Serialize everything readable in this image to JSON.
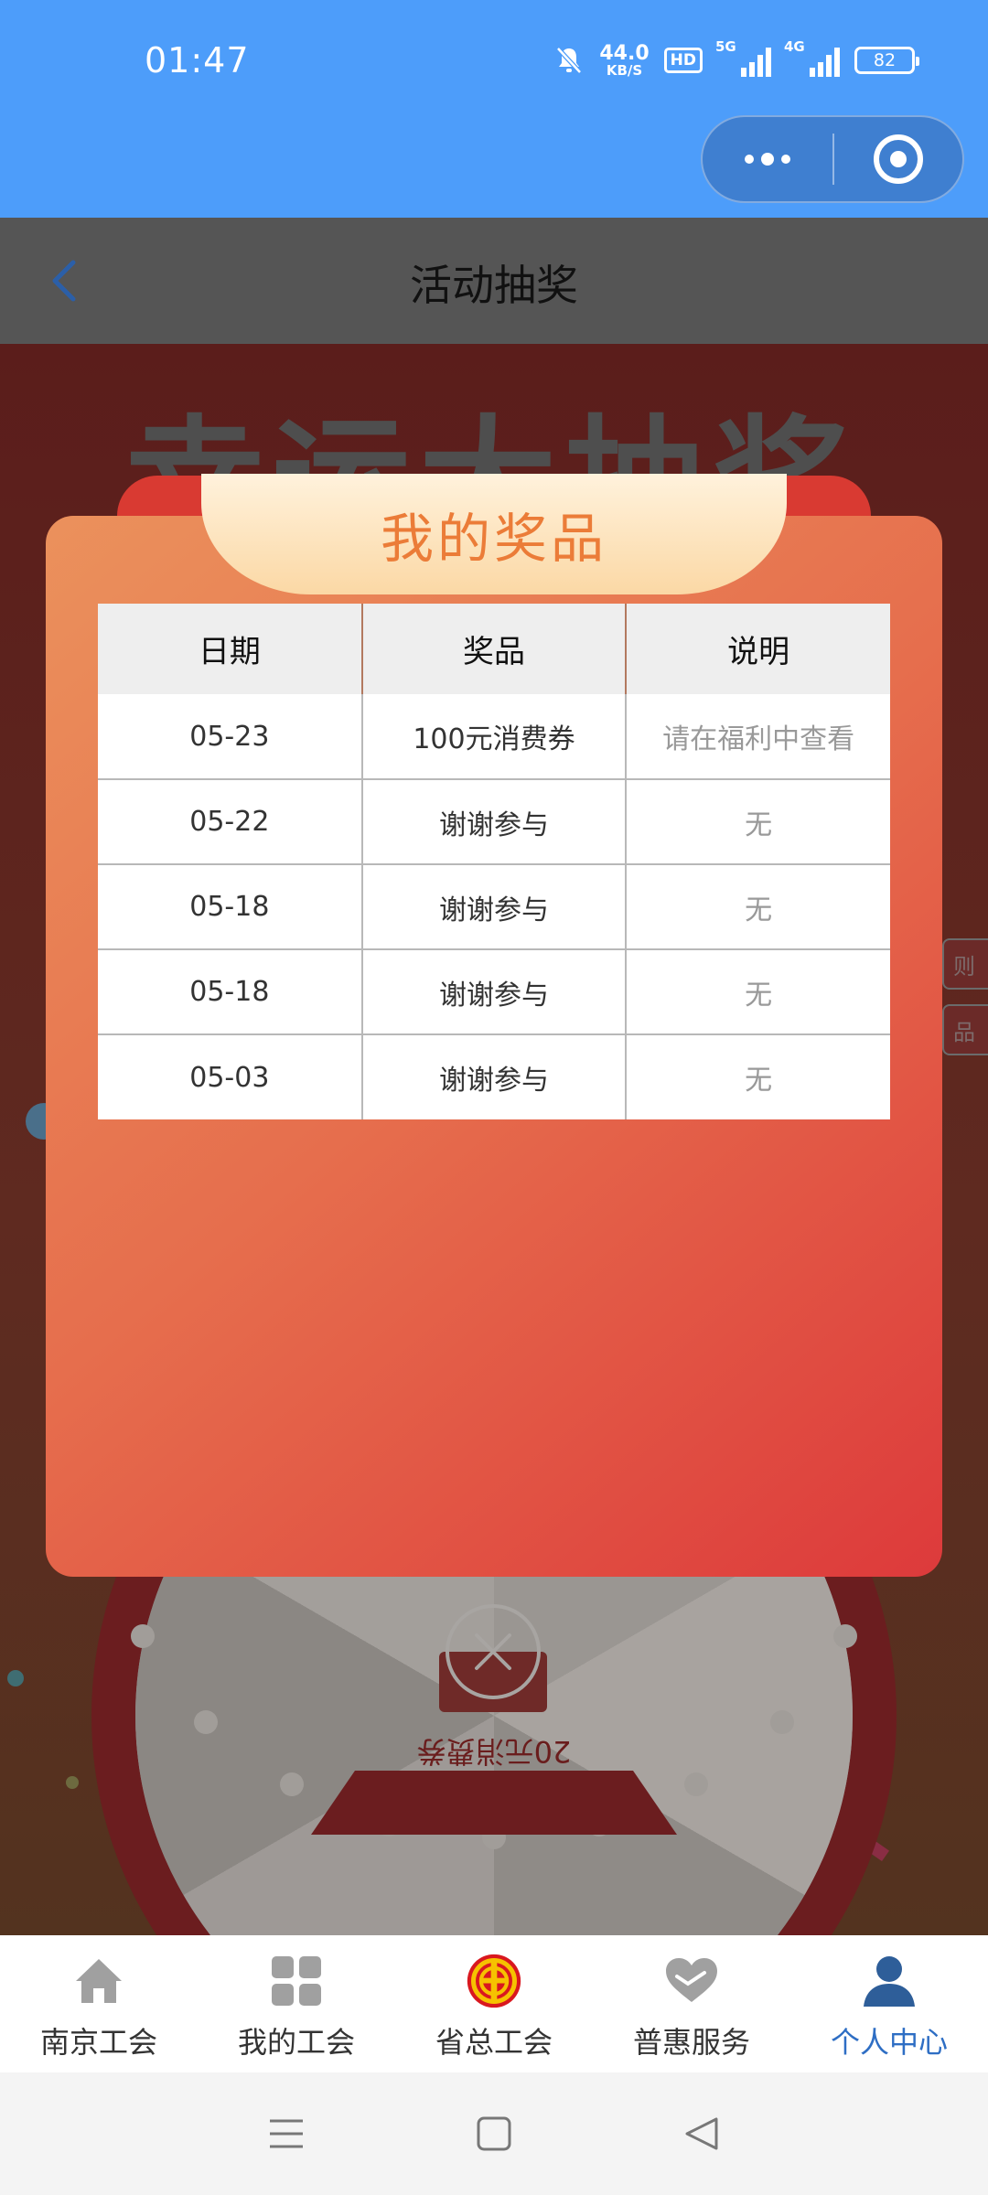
{
  "status_bar": {
    "time": "01:47",
    "net_speed_value": "44.0",
    "net_speed_unit": "KB/S",
    "hd_label": "HD",
    "signal1_label": "5G",
    "signal2_label": "4G",
    "battery": "82"
  },
  "capsule": {
    "more_icon": "more-dots-icon",
    "close_icon": "target-circle-icon"
  },
  "header": {
    "title": "活动抽奖",
    "back_icon": "chevron-left-icon"
  },
  "background": {
    "banner_text": "幸运大抽奖",
    "side_tab_1": "则",
    "side_tab_2": "品",
    "wheel_prize_text": "20元消费券"
  },
  "modal": {
    "title": "我的奖品",
    "columns": [
      "日期",
      "奖品",
      "说明"
    ],
    "rows": [
      {
        "date": "05-23",
        "prize": "100元消费券",
        "note": "请在福利中查看"
      },
      {
        "date": "05-22",
        "prize": "谢谢参与",
        "note": "无"
      },
      {
        "date": "05-18",
        "prize": "谢谢参与",
        "note": "无"
      },
      {
        "date": "05-18",
        "prize": "谢谢参与",
        "note": "无"
      },
      {
        "date": "05-03",
        "prize": "谢谢参与",
        "note": "无"
      }
    ],
    "close_icon": "close-circle-icon"
  },
  "tab_bar": {
    "items": [
      {
        "label": "南京工会",
        "icon": "home-icon"
      },
      {
        "label": "我的工会",
        "icon": "grid-icon"
      },
      {
        "label": "省总工会",
        "icon": "union-emblem-icon"
      },
      {
        "label": "普惠服务",
        "icon": "heart-hand-icon"
      },
      {
        "label": "个人中心",
        "icon": "person-icon"
      }
    ],
    "active_index": 4
  },
  "colors": {
    "status_bar": "#4d9dfa",
    "modal_orange": "#eb915c",
    "modal_red": "#dd3a3b",
    "title_orange": "#eb7c38",
    "active_tab": "#2e6ec4"
  }
}
